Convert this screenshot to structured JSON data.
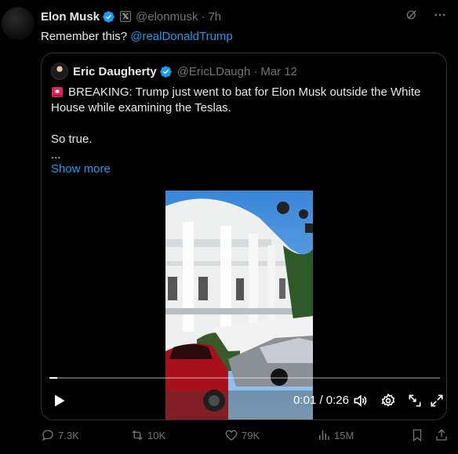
{
  "tweet": {
    "author_name": "Elon Musk",
    "author_handle": "@elonmusk",
    "time": "7h",
    "text_prefix": "Remember this? ",
    "mention": "@realDonaldTrump"
  },
  "quote": {
    "author_name": "Eric Daugherty",
    "author_handle": "@EricLDaugh",
    "date": "Mar 12",
    "line1": "BREAKING: Trump just went to bat for Elon Musk outside the White House while examining the Teslas.",
    "line2": "So true.",
    "line3": "...",
    "show_more": "Show more",
    "video": {
      "timecode": "0:01 / 0:26",
      "progress": 0.02
    }
  },
  "actions": {
    "replies": "7.3K",
    "reposts": "10K",
    "likes": "79K",
    "views": "15M"
  },
  "colors": {
    "accent": "#1d9bf0",
    "muted": "#71767b",
    "border": "#2f3336"
  }
}
